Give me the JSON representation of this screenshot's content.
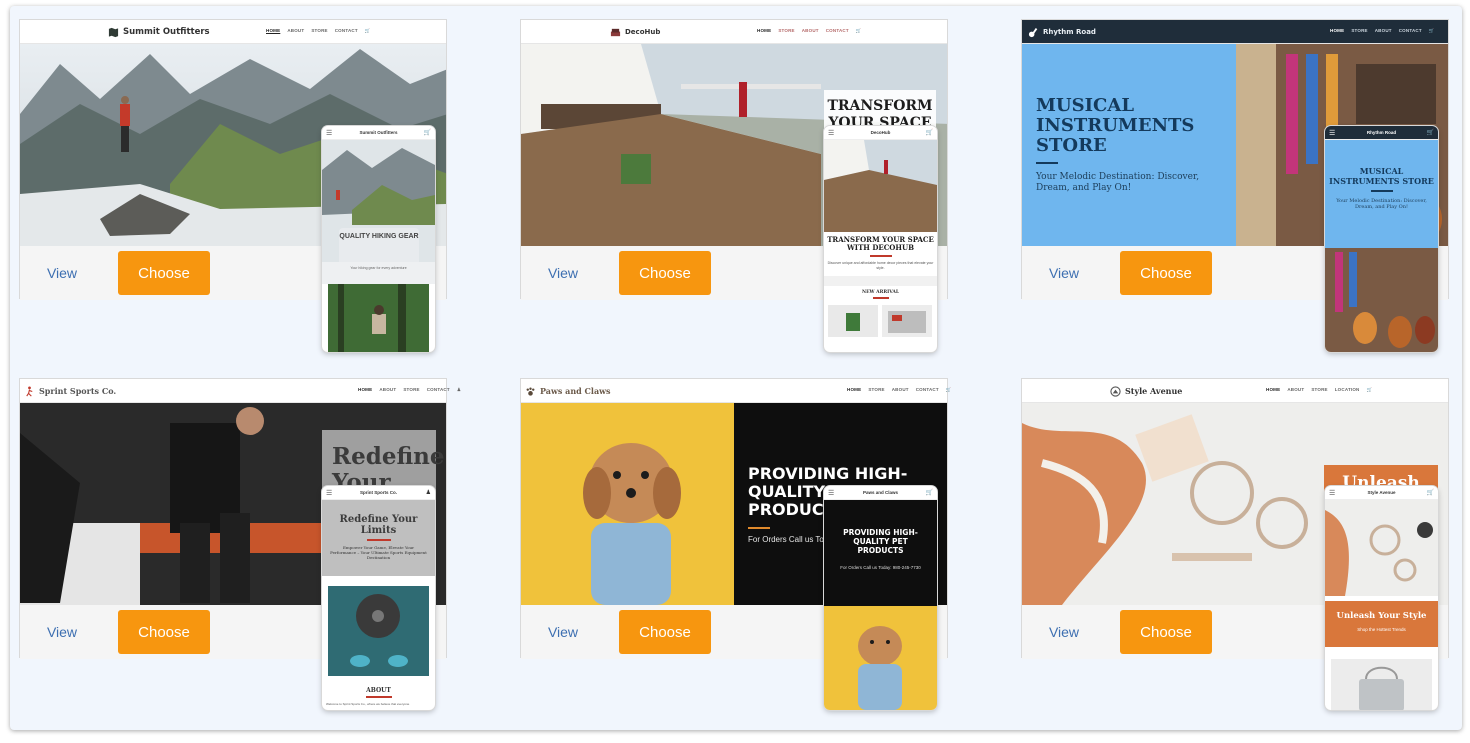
{
  "actions": {
    "view_label": "View",
    "choose_label": "Choose"
  },
  "colors": {
    "choose": "#f7960f",
    "view": "#3d6fb1",
    "frame_bg": "#f1f6fd"
  },
  "templates": [
    {
      "brand": "Summit Outfitters",
      "brand_icon": "map-icon",
      "nav": [
        "HOME",
        "ABOUT",
        "STORE",
        "CONTACT"
      ],
      "mobile": {
        "brand": "Summit Outfitters",
        "hero_title": "QUALITY HIKING GEAR",
        "hero_sub": "Your hiking gear for every adventure"
      }
    },
    {
      "brand": "DecoHub",
      "brand_icon": "sofa-icon",
      "nav": [
        "HOME",
        "STORE",
        "ABOUT",
        "CONTACT"
      ],
      "hero_title": "TRANSFORM YOUR SPACE",
      "mobile": {
        "brand": "DecoHub",
        "hero_title": "TRANSFORM YOUR SPACE WITH DECOHUB",
        "hero_sub": "Discover unique and affordable home decor pieces that elevate your style.",
        "section": "NEW ARRIVAL"
      }
    },
    {
      "brand": "Rhythm Road",
      "brand_icon": "guitar-icon",
      "nav": [
        "HOME",
        "STORE",
        "ABOUT",
        "CONTACT"
      ],
      "hero_title": "MUSICAL INSTRUMENTS STORE",
      "hero_sub": "Your Melodic Destination: Discover, Dream, and Play On!",
      "mobile": {
        "brand": "Rhythm Road",
        "hero_title": "MUSICAL INSTRUMENTS STORE",
        "hero_sub": "Your Melodic Destination: Discover, Dream, and Play On!"
      }
    },
    {
      "brand": "Sprint Sports Co.",
      "brand_icon": "runner-icon",
      "nav": [
        "HOME",
        "ABOUT",
        "STORE",
        "CONTACT"
      ],
      "hero_title": "Redefine Your",
      "mobile": {
        "brand": "Sprint Sports Co.",
        "hero_title": "Redefine Your Limits",
        "hero_sub": "Empower Your Game, Elevate Your Performance – Your Ultimate Sports Equipment Destination",
        "section": "ABOUT",
        "about_text": "Welcome to Sprint Sports Co., where we believe that everyone"
      }
    },
    {
      "brand": "Paws and Claws",
      "brand_icon": "paw-icon",
      "nav": [
        "HOME",
        "STORE",
        "ABOUT",
        "CONTACT"
      ],
      "hero_title": "PROVIDING HIGH-QUALITY PET PRODUCTS",
      "hero_sub": "For Orders Call us Today",
      "mobile": {
        "brand": "Paws and Claws",
        "hero_title": "PROVIDING HIGH-QUALITY PET PRODUCTS",
        "hero_sub": "For Orders Call us Today: 980-245-7730"
      }
    },
    {
      "brand": "Style Avenue",
      "brand_icon": "hanger-icon",
      "nav": [
        "HOME",
        "ABOUT",
        "STORE",
        "LOCATION"
      ],
      "hero_title": "Unleash",
      "mobile": {
        "brand": "Style Avenue",
        "hero_title": "Unleash Your Style",
        "hero_sub": "Shop the Hottest Trends"
      }
    }
  ]
}
